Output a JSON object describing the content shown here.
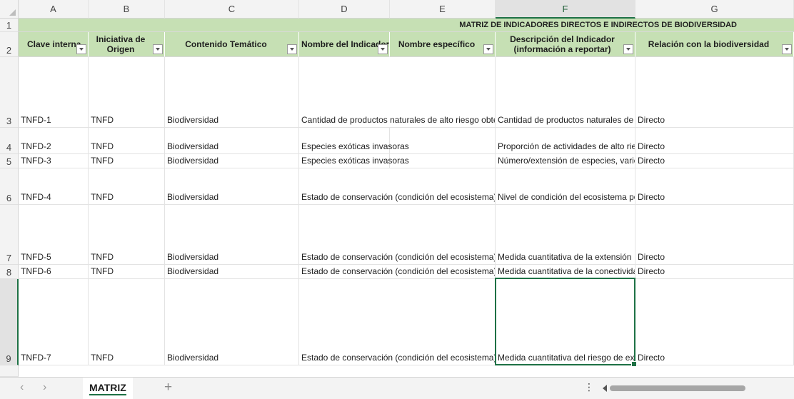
{
  "columns": [
    "A",
    "B",
    "C",
    "D",
    "E",
    "F",
    "G"
  ],
  "rows": [
    "1",
    "2",
    "3",
    "4",
    "5",
    "6",
    "7",
    "8",
    "9"
  ],
  "title": "MATRIZ DE INDICADORES DIRECTOS E INDIRECTOS DE BIODIVERSIDAD",
  "headers": {
    "A": "Clave interna",
    "B": "Iniciativa de Origen",
    "C": "Contenido Temático",
    "D": "Nombre del Indicador",
    "E": "Nombre específico",
    "F": "Descripción del Indicador (información a reportar)",
    "G": "Relación con la biodiversidad"
  },
  "data": [
    {
      "clave": "TNFD-1",
      "origen": "TNFD",
      "contenido": "Biodiversidad",
      "nombre": "Cantidad de productos naturales de alto riesgo obtenidos",
      "especifico": "",
      "descripcion": "Cantidad de productos naturales de alto riesgo",
      "relacion": "Directo"
    },
    {
      "clave": "TNFD-2",
      "origen": "TNFD",
      "contenido": "Biodiversidad",
      "nombre": "Especies exóticas invasoras",
      "especifico": "",
      "descripcion": "Proporción de actividades de alto riesgo",
      "relacion": "Directo"
    },
    {
      "clave": "TNFD-3",
      "origen": "TNFD",
      "contenido": "Biodiversidad",
      "nombre": "Especies exóticas invasoras",
      "especifico": "",
      "descripcion": "Número/extensión de especies, variedades",
      "relacion": "Directo"
    },
    {
      "clave": "TNFD-4",
      "origen": "TNFD",
      "contenido": "Biodiversidad",
      "nombre": "Estado de conservación (condición del ecosistema)",
      "especifico": "",
      "descripcion": "Nivel de condición del ecosistema por tipo",
      "relacion": "Directo"
    },
    {
      "clave": "TNFD-5",
      "origen": "TNFD",
      "contenido": "Biodiversidad",
      "nombre": "Estado de conservación (condición del ecosistema)",
      "especifico": "",
      "descripcion": "Medida cuantitativa de la extensión",
      "relacion": "Directo"
    },
    {
      "clave": "TNFD-6",
      "origen": "TNFD",
      "contenido": "Biodiversidad",
      "nombre": "Estado de conservación (condición del ecosistema)",
      "especifico": "",
      "descripcion": "Medida cuantitativa de la conectividad",
      "relacion": "Directo"
    },
    {
      "clave": "TNFD-7",
      "origen": "TNFD",
      "contenido": "Biodiversidad",
      "nombre": "Estado de conservación (condición del ecosistema)",
      "especifico": "",
      "descripcion": "Medida cuantitativa del riesgo de extinción",
      "relacion": "Directo"
    }
  ],
  "sheet_tab": "MATRIZ",
  "colors": {
    "header_green": "#c6e0b4",
    "accent": "#1e7145"
  }
}
